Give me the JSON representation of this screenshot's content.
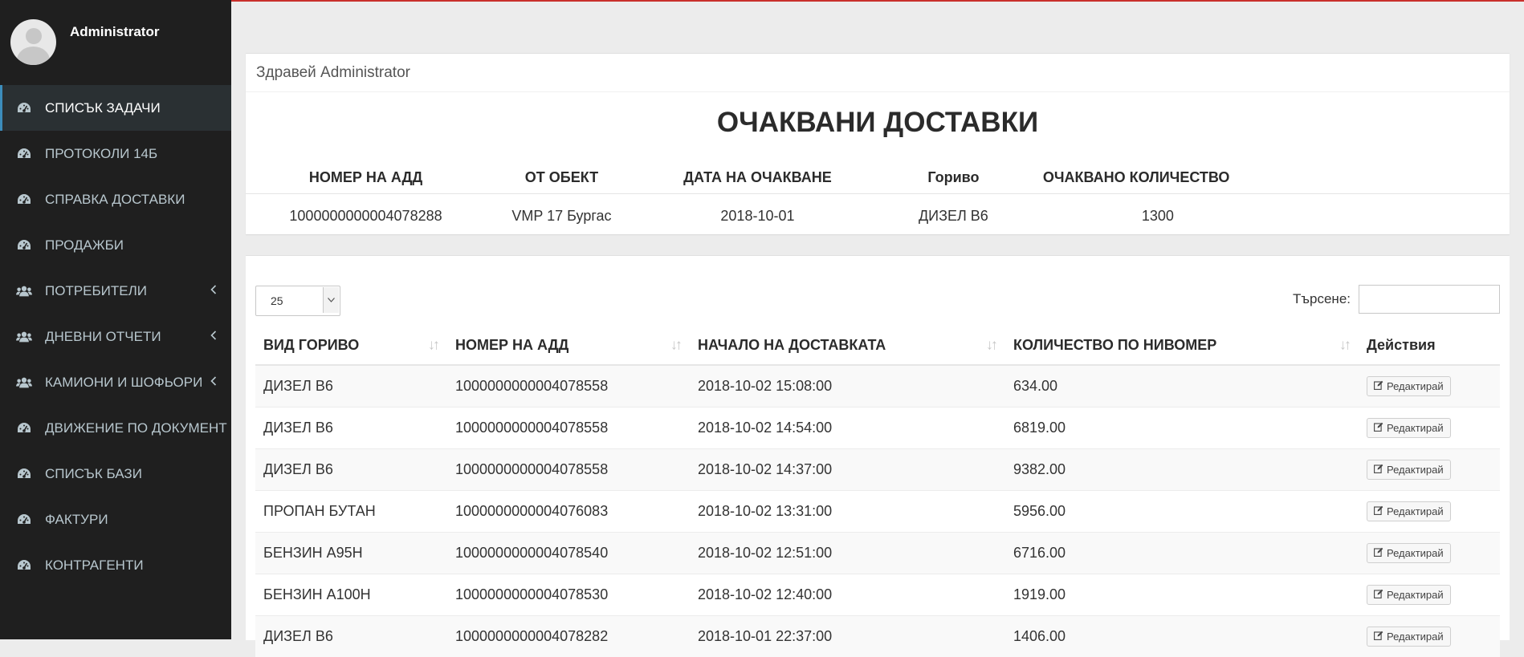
{
  "user": {
    "name": "Administrator"
  },
  "sidebar": {
    "items": [
      {
        "label": "СПИСЪК ЗАДАЧИ",
        "icon": "dashboard-icon",
        "active": true
      },
      {
        "label": "ПРОТОКОЛИ 14Б",
        "icon": "dashboard-icon"
      },
      {
        "label": "СПРАВКА ДОСТАВКИ",
        "icon": "dashboard-icon"
      },
      {
        "label": "ПРОДАЖБИ",
        "icon": "dashboard-icon"
      },
      {
        "label": "ПОТРЕБИТЕЛИ",
        "icon": "users-icon",
        "submenu": true
      },
      {
        "label": "ДНЕВНИ ОТЧЕТИ",
        "icon": "users-icon",
        "submenu": true
      },
      {
        "label": "КАМИОНИ И ШОФЬОРИ",
        "icon": "users-icon",
        "submenu": true
      },
      {
        "label": "ДВИЖЕНИЕ ПО ДОКУМЕНТ",
        "icon": "dashboard-icon"
      },
      {
        "label": "СПИСЪК БАЗИ",
        "icon": "dashboard-icon"
      },
      {
        "label": "ФАКТУРИ",
        "icon": "dashboard-icon"
      },
      {
        "label": "КОНТРАГЕНТИ",
        "icon": "dashboard-icon"
      }
    ]
  },
  "greeting": "Здравей Administrator",
  "expected": {
    "title": "ОЧАКВАНИ ДОСТАВКИ",
    "headers": [
      "НОМЕР НА АДД",
      "ОТ ОБЕКТ",
      "ДАТА НА ОЧАКВАНЕ",
      "Гориво",
      "ОЧАКВАНО КОЛИЧЕСТВО"
    ],
    "row": [
      "1000000000004078288",
      "VMP 17 Бургас",
      "2018-10-01",
      "ДИЗЕЛ B6",
      "1300"
    ]
  },
  "table": {
    "page_size": "25",
    "search_label": "Търсене:",
    "search_value": "",
    "headers": [
      "ВИД ГОРИВО",
      "НОМЕР НА АДД",
      "НАЧАЛО НА ДОСТАВКАТА",
      "КОЛИЧЕСТВО ПО НИВОМЕР",
      "Действия"
    ],
    "edit_label": "Редактирай",
    "rows": [
      [
        "ДИЗЕЛ B6",
        "1000000000004078558",
        "2018-10-02 15:08:00",
        "634.00"
      ],
      [
        "ДИЗЕЛ B6",
        "1000000000004078558",
        "2018-10-02 14:54:00",
        "6819.00"
      ],
      [
        "ДИЗЕЛ B6",
        "1000000000004078558",
        "2018-10-02 14:37:00",
        "9382.00"
      ],
      [
        "ПРОПАН БУТАН",
        "1000000000004076083",
        "2018-10-02 13:31:00",
        "5956.00"
      ],
      [
        "БЕНЗИН A95H",
        "1000000000004078540",
        "2018-10-02 12:51:00",
        "6716.00"
      ],
      [
        "БЕНЗИН A100H",
        "1000000000004078530",
        "2018-10-02 12:40:00",
        "1919.00"
      ],
      [
        "ДИЗЕЛ B6",
        "1000000000004078282",
        "2018-10-01 22:37:00",
        "1406.00"
      ]
    ]
  }
}
